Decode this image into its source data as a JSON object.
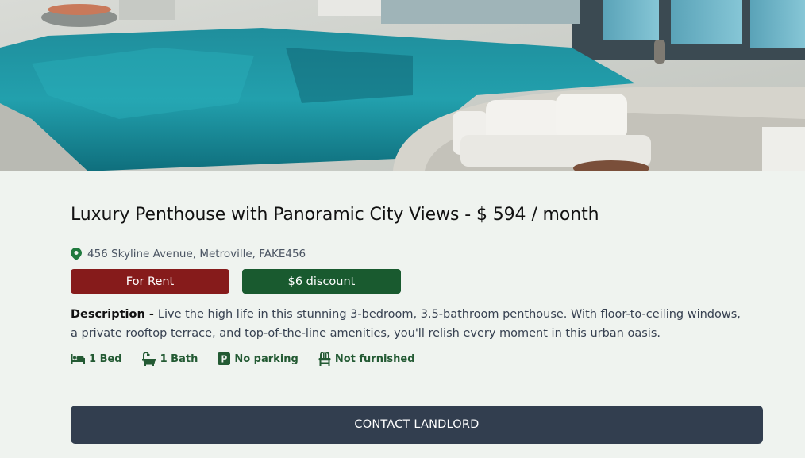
{
  "listing": {
    "title": "Luxury Penthouse with Panoramic City Views - $ 594 / month",
    "address": "456 Skyline Avenue, Metroville, FAKE456",
    "status_badge": "For Rent",
    "discount_badge": "$6 discount",
    "description_label": "Description - ",
    "description_text": "Live the high life in this stunning 3-bedroom, 3.5-bathroom penthouse. With floor-to-ceiling windows, a private rooftop terrace, and top-of-the-line amenities, you'll relish every moment in this urban oasis.",
    "features": [
      {
        "icon": "bed-icon",
        "label": "1 Bed"
      },
      {
        "icon": "bath-icon",
        "label": "1 Bath"
      },
      {
        "icon": "parking-icon",
        "label": "No parking"
      },
      {
        "icon": "chair-icon",
        "label": "Not furnished"
      }
    ],
    "contact_label": "CONTACT LANDLORD"
  },
  "colors": {
    "background": "#eff3ef",
    "rent_badge": "#861b1b",
    "discount_badge": "#195a2f",
    "feature_text": "#235a33",
    "contact_button": "#323e4f"
  }
}
